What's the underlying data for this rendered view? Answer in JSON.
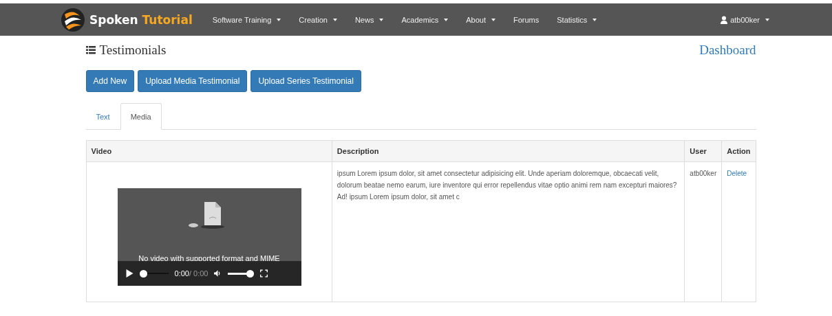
{
  "navbar": {
    "brand": {
      "first": "Spoken",
      "second": "Tutorial"
    },
    "menu": [
      {
        "label": "Software Training",
        "dropdown": true
      },
      {
        "label": "Creation",
        "dropdown": true
      },
      {
        "label": "News",
        "dropdown": true
      },
      {
        "label": "Academics",
        "dropdown": true
      },
      {
        "label": "About",
        "dropdown": true
      },
      {
        "label": "Forums",
        "dropdown": false
      },
      {
        "label": "Statistics",
        "dropdown": true
      }
    ],
    "user": "atb00ker"
  },
  "page": {
    "title": "Testimonials",
    "dashboard_link": "Dashboard"
  },
  "buttons": [
    "Add New",
    "Upload Media Testimonial",
    "Upload Series Testimonial"
  ],
  "tabs": [
    {
      "label": "Text",
      "selected": false
    },
    {
      "label": "Media",
      "selected": true
    }
  ],
  "table": {
    "columns": [
      "Video",
      "Description",
      "User",
      "Action"
    ],
    "rows": [
      {
        "video": {
          "message": "No video with supported format and MIME",
          "time": "0:00",
          "duration": "/ 0:00",
          "progress": {
            "level": 0
          },
          "volume": {
            "level": 0.85
          }
        },
        "description": "ipsum Lorem ipsum dolor, sit amet consectetur adipisicing elit. Unde aperiam doloremque, obcaecati velit, dolorum beatae nemo earum, iure inventore qui error repellendus vitae optio animi rem nam excepturi maiores? Ad! ipsum Lorem ipsum dolor, sit amet c",
        "user": "atb00ker",
        "action": "Delete"
      }
    ]
  }
}
